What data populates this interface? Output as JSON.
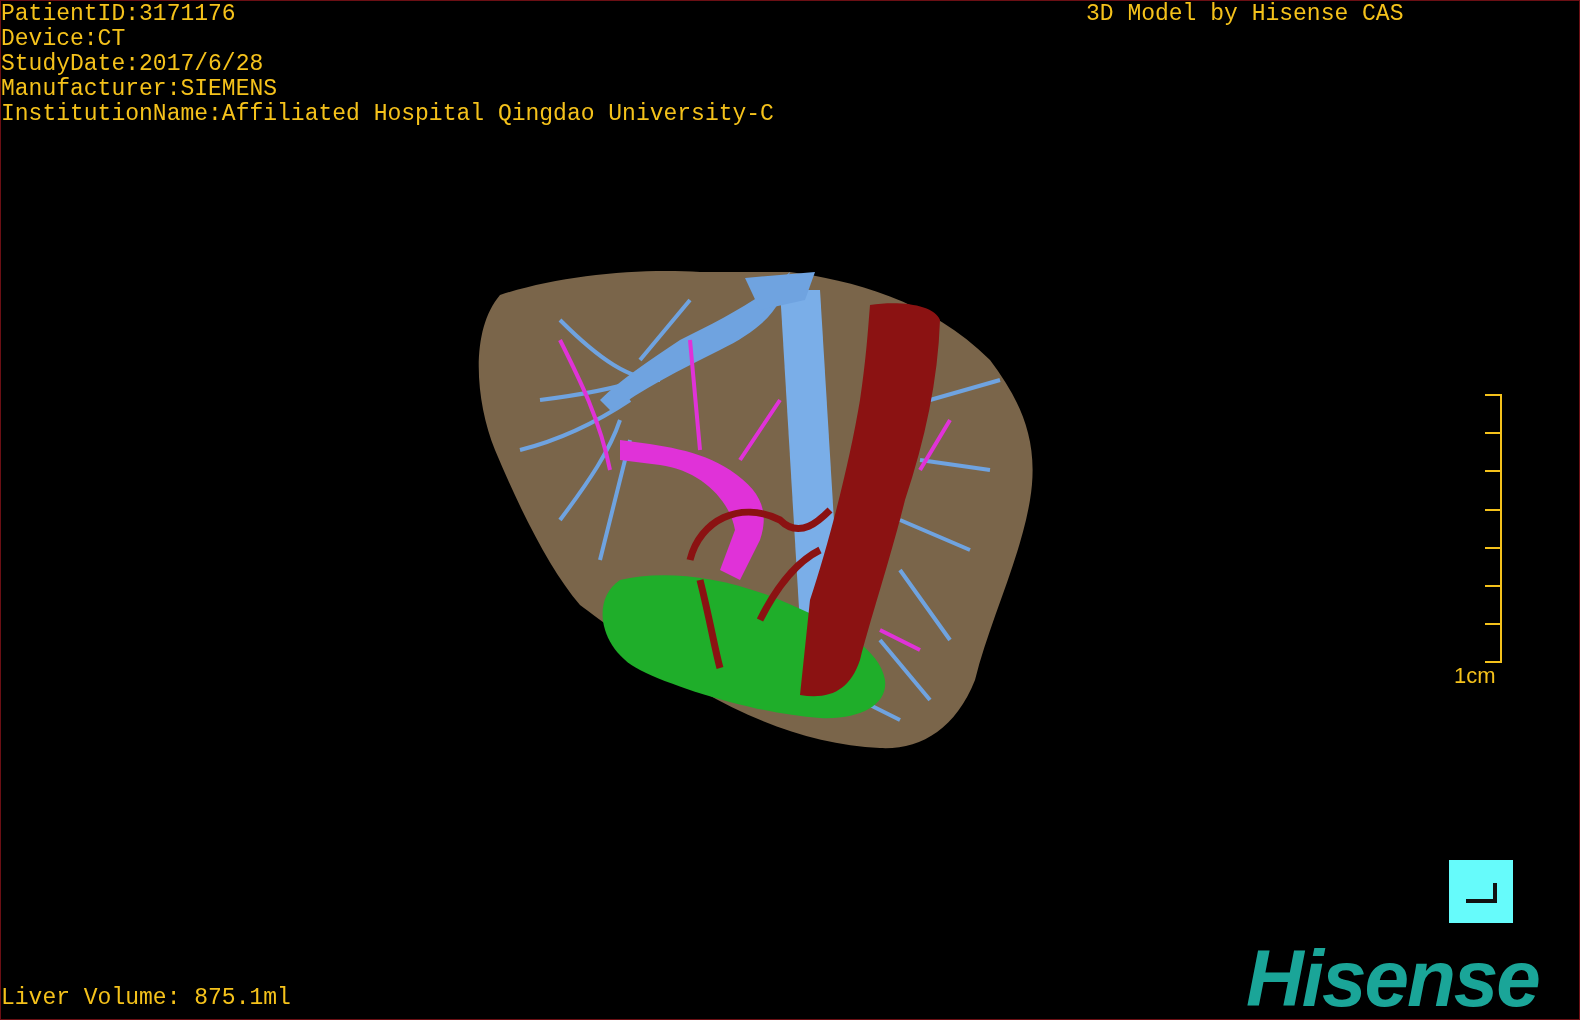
{
  "info_lines": [
    "PatientID:3171176",
    "Device:CT",
    "StudyDate:2017/6/28",
    "Manufacturer:SIEMENS",
    "InstitutionName:Affiliated Hospital Qingdao University-C"
  ],
  "title": "3D Model by Hisense CAS",
  "scale_bar": {
    "label": "1cm"
  },
  "liver_volume": "Liver Volume: 875.1ml",
  "logo": "Hisense"
}
